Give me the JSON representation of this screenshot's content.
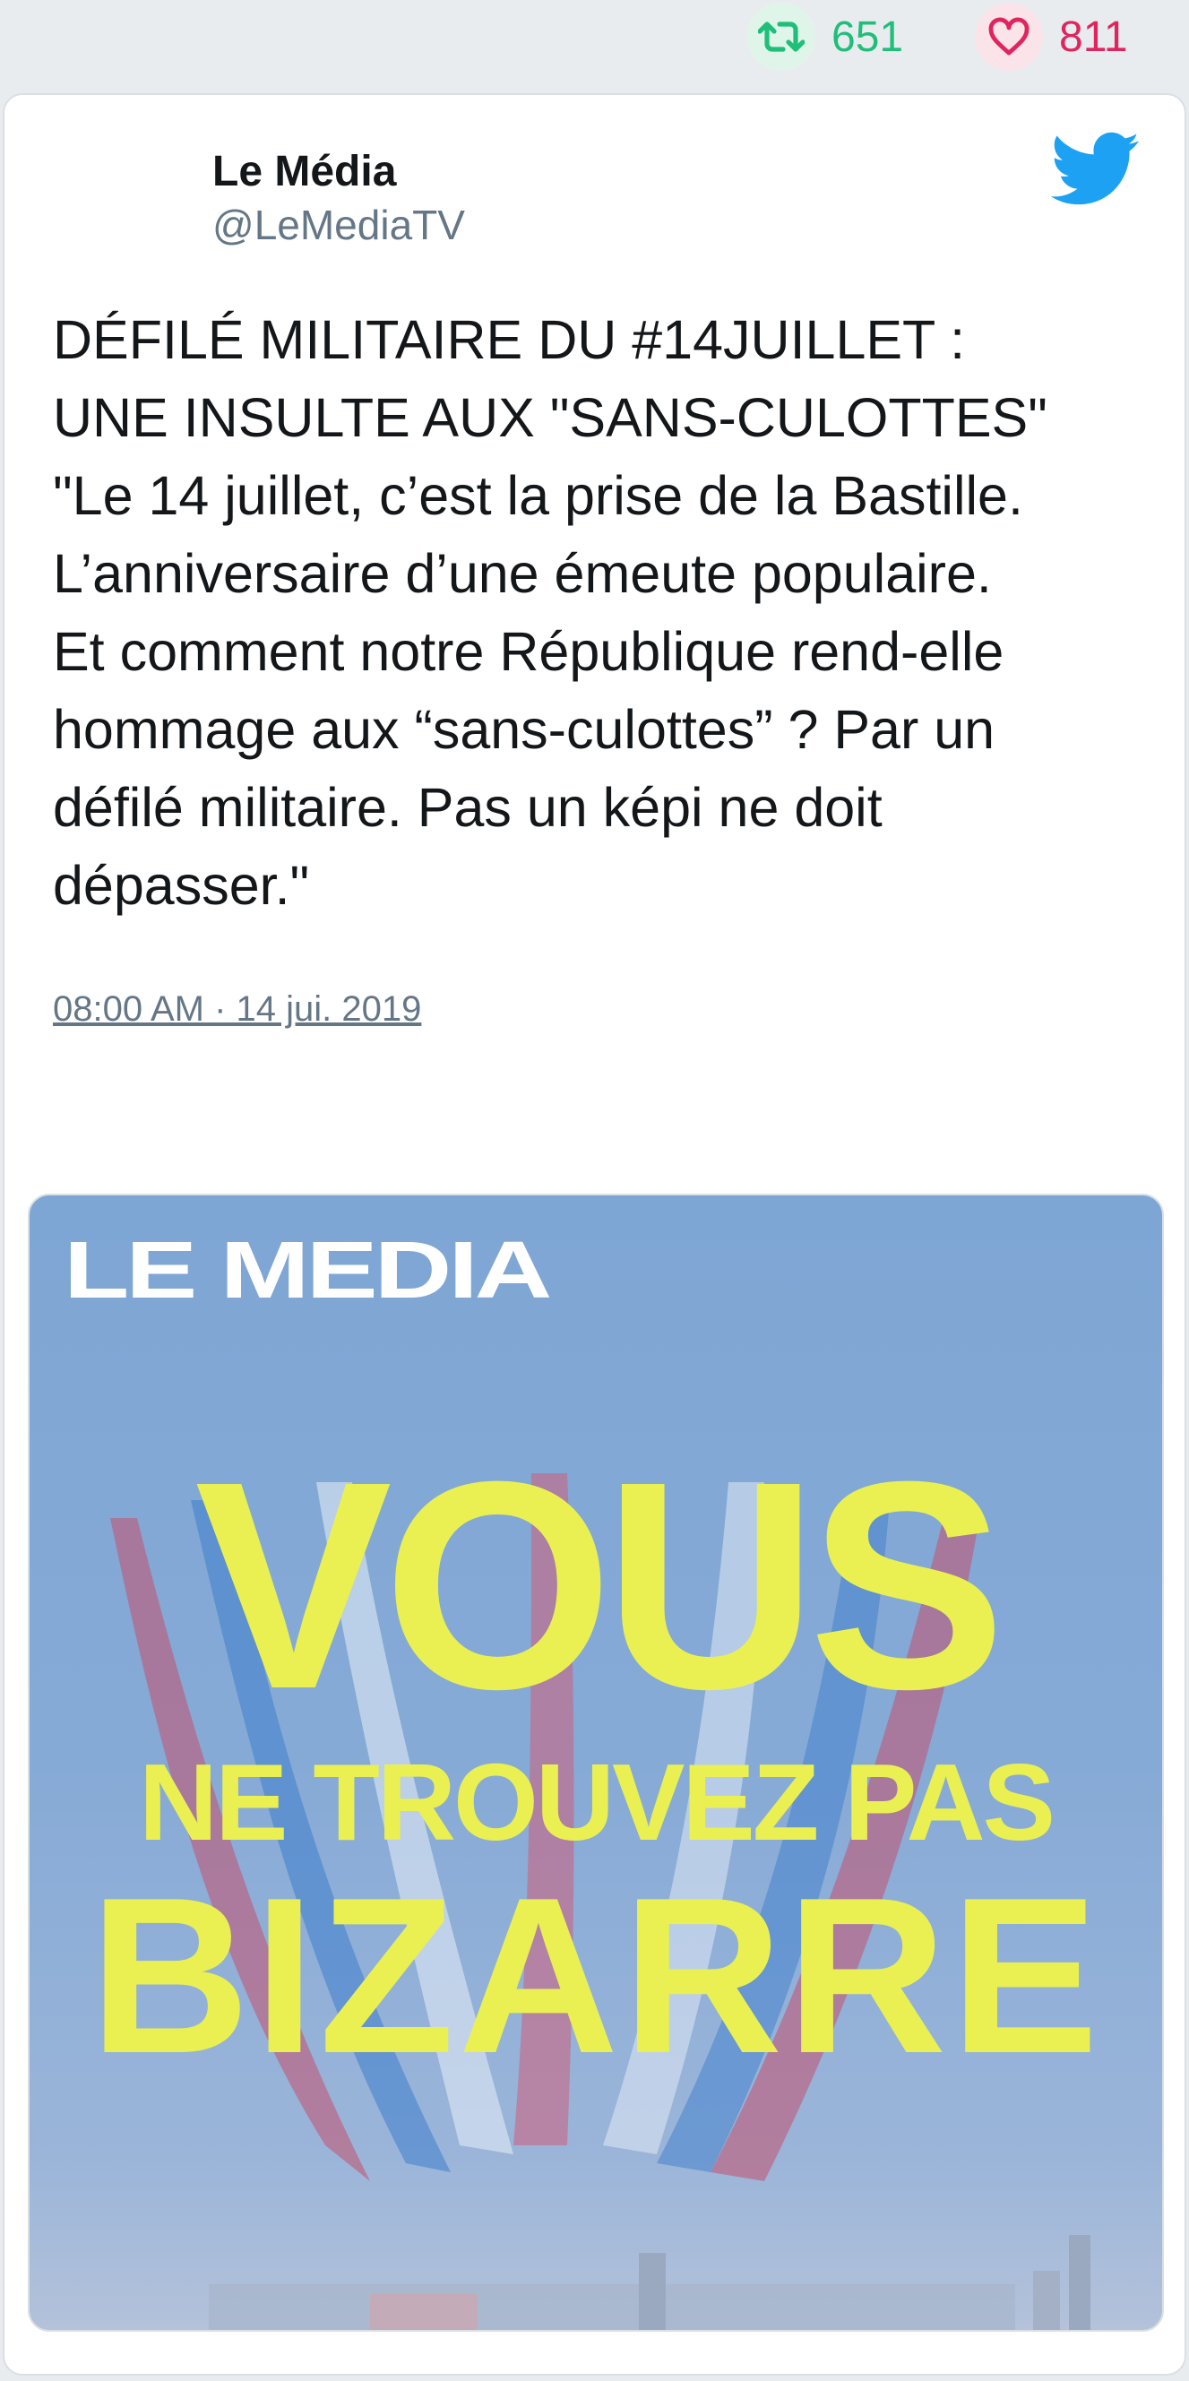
{
  "stats": {
    "retweets": "651",
    "likes": "811"
  },
  "author": {
    "name": "Le Média",
    "handle": "@LeMediaTV"
  },
  "tweet": {
    "text": "DÉFILÉ MILITAIRE DU #14JUILLET :\nUNE INSULTE AUX \"SANS-CULOTTES\"\n\"Le 14 juillet, c’est la prise de la Bastille.\nL’anniversaire d’une émeute populaire.\nEt comment notre République rend-elle\nhommage aux “sans-culottes” ? Par un\ndéfilé militaire. Pas un képi ne doit\ndépasser.\"",
    "timestamp": "08:00 AM · 14 jui. 2019"
  },
  "media": {
    "logo": "LE MEDIA",
    "line1": "VOUS",
    "line2": "NE TROUVEZ PAS",
    "line3": "BIZARRE"
  },
  "icons": {
    "stat_retweet": "retweet-icon",
    "stat_like": "heart-icon",
    "brand": "twitter-bird-icon",
    "reply": "reply-icon",
    "retweet": "retweet-icon",
    "like": "heart-icon"
  },
  "colors": {
    "retweet": "#1fbf7a",
    "like": "#e0245e",
    "twitter_blue": "#1da1f2",
    "headline_yellow": "#eaf052"
  }
}
